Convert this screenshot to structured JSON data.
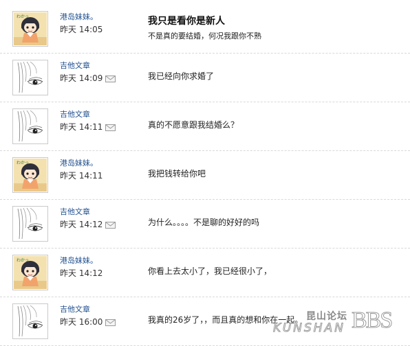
{
  "messages": [
    {
      "author": "港岛妹妹。",
      "avatar": "girl-avatar-icon",
      "time": "昨天 14:05",
      "has_mail_icon": false,
      "title": "我只是看你是新人",
      "body": "不是真的要结婚，何况我跟你不熟"
    },
    {
      "author": "吉他文章",
      "avatar": "sketch-eye-avatar-icon",
      "time": "昨天 14:09",
      "has_mail_icon": true,
      "title": "",
      "body": "我已经向你求婚了"
    },
    {
      "author": "吉他文章",
      "avatar": "sketch-eye-avatar-icon",
      "time": "昨天 14:11",
      "has_mail_icon": true,
      "title": "",
      "body": "真的不愿意跟我结婚么？"
    },
    {
      "author": "港岛妹妹。",
      "avatar": "girl-avatar-icon",
      "time": "昨天 14:11",
      "has_mail_icon": false,
      "title": "",
      "body": "我把钱转给你吧"
    },
    {
      "author": "吉他文章",
      "avatar": "sketch-eye-avatar-icon",
      "time": "昨天 14:12",
      "has_mail_icon": true,
      "title": "",
      "body": "为什么。。。。不是聊的好好的吗"
    },
    {
      "author": "港岛妹妹。",
      "avatar": "girl-avatar-icon",
      "time": "昨天 14:12",
      "has_mail_icon": false,
      "title": "",
      "body": "你看上去太小了，我已经很小了，"
    },
    {
      "author": "吉他文章",
      "avatar": "sketch-eye-avatar-icon",
      "time": "昨天 16:00",
      "has_mail_icon": true,
      "title": "",
      "body": "我真的26岁了，，而且真的想和你在一起。"
    }
  ],
  "watermark": {
    "cn": "昆山论坛",
    "en": "KUNSHAN",
    "bbs": "BBS"
  },
  "colors": {
    "author": "#1f4f8f",
    "divider": "#d8d8d8"
  }
}
